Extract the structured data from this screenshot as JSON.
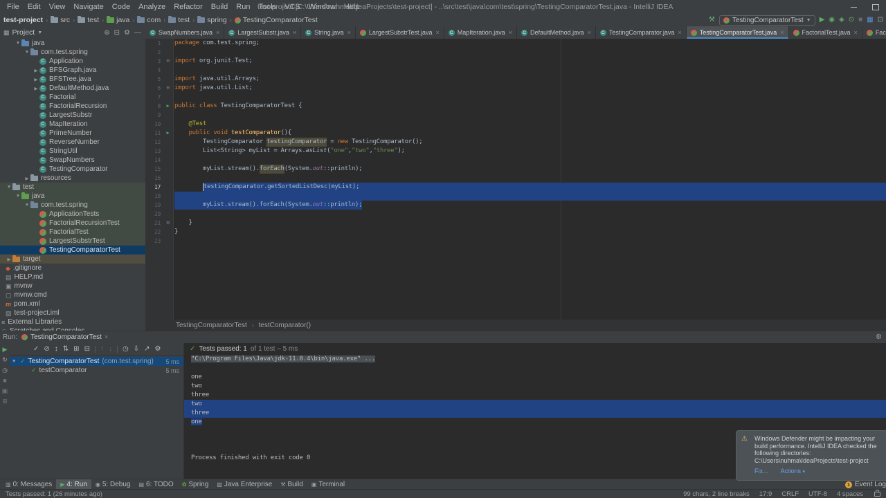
{
  "colors": {
    "accent": "#4A88C7",
    "selection": "#214283",
    "pass_green": "#5fad65",
    "badge_orange": "#e0a23a"
  },
  "titlebar": {
    "menus": [
      "File",
      "Edit",
      "View",
      "Navigate",
      "Code",
      "Analyze",
      "Refactor",
      "Build",
      "Run",
      "Tools",
      "VCS",
      "Window",
      "Help"
    ],
    "title": "test-project [C:\\Users\\nuhma\\IdeaProjects\\test-project] - ..\\src\\test\\java\\com\\test\\spring\\TestingComparatorTest.java - IntelliJ IDEA"
  },
  "navbar": {
    "breadcrumbs": [
      {
        "label": "test-project",
        "icon": null
      },
      {
        "label": "src",
        "icon": "folder"
      },
      {
        "label": "test",
        "icon": "folder"
      },
      {
        "label": "java",
        "icon": "folder-green"
      },
      {
        "label": "com",
        "icon": "pkg"
      },
      {
        "label": "test",
        "icon": "pkg"
      },
      {
        "label": "spring",
        "icon": "pkg"
      },
      {
        "label": "TestingComparatorTest",
        "icon": "testclass"
      }
    ],
    "run_config": "TestingComparatorTest",
    "actions": [
      {
        "t": "icon",
        "g": "⚒",
        "c": "#6aab73",
        "n": "build-hammer-icon"
      },
      {
        "t": "combo"
      },
      {
        "t": "icon",
        "g": "▶",
        "c": "#5fad65",
        "n": "run-button"
      },
      {
        "t": "icon",
        "g": "◉",
        "c": "#5fad65",
        "n": "debug-button"
      },
      {
        "t": "icon",
        "g": "◈",
        "c": "#6aab73",
        "n": "coverage-button"
      },
      {
        "t": "icon",
        "g": "⊙",
        "c": "#6aab73",
        "n": "profiler-button"
      },
      {
        "t": "icon",
        "g": "■",
        "c": "#666b6e",
        "n": "stop-button"
      },
      {
        "t": "icon",
        "g": "▦",
        "c": "#5a8fd6",
        "n": "project-structure-button"
      },
      {
        "t": "icon",
        "g": "⊡",
        "c": "#9fa3a6",
        "n": "preview-button"
      }
    ]
  },
  "project": {
    "header": "Project",
    "header_icons": [
      {
        "g": "⊕",
        "n": "locate-icon"
      },
      {
        "g": "⊟",
        "n": "collapse-all-icon"
      },
      {
        "g": "⚙",
        "n": "settings-icon"
      },
      {
        "g": "―",
        "n": "hide-panel-icon"
      }
    ],
    "items": [
      {
        "l": "java",
        "d": 2,
        "ch": "open",
        "ic": "folder-src",
        "tint": ""
      },
      {
        "l": "com.test.spring",
        "d": 3,
        "ch": "open",
        "ic": "pkg",
        "tint": ""
      },
      {
        "l": "Application",
        "d": 4,
        "ch": "blank",
        "ic": "class",
        "tint": ""
      },
      {
        "l": "BFSGraph.java",
        "d": 4,
        "ch": "closed",
        "ic": "class",
        "tint": ""
      },
      {
        "l": "BFSTree.java",
        "d": 4,
        "ch": "closed",
        "ic": "class",
        "tint": ""
      },
      {
        "l": "DefaultMethod.java",
        "d": 4,
        "ch": "closed",
        "ic": "class",
        "tint": ""
      },
      {
        "l": "Factorial",
        "d": 4,
        "ch": "blank",
        "ic": "class",
        "tint": ""
      },
      {
        "l": "FactorialRecursion",
        "d": 4,
        "ch": "blank",
        "ic": "class",
        "tint": ""
      },
      {
        "l": "LargestSubstr",
        "d": 4,
        "ch": "blank",
        "ic": "class",
        "tint": ""
      },
      {
        "l": "MapIteration",
        "d": 4,
        "ch": "blank",
        "ic": "class",
        "tint": ""
      },
      {
        "l": "PrimeNumber",
        "d": 4,
        "ch": "blank",
        "ic": "class",
        "tint": ""
      },
      {
        "l": "ReverseNumber",
        "d": 4,
        "ch": "blank",
        "ic": "class",
        "tint": ""
      },
      {
        "l": "StringUtil",
        "d": 4,
        "ch": "blank",
        "ic": "class",
        "tint": ""
      },
      {
        "l": "SwapNumbers",
        "d": 4,
        "ch": "blank",
        "ic": "class",
        "tint": ""
      },
      {
        "l": "TestingComparator",
        "d": 4,
        "ch": "blank",
        "ic": "class",
        "tint": ""
      },
      {
        "l": "resources",
        "d": 3,
        "ch": "closed",
        "ic": "folder",
        "tint": ""
      },
      {
        "l": "test",
        "d": 1,
        "ch": "open",
        "ic": "folder",
        "tint": "green"
      },
      {
        "l": "java",
        "d": 2,
        "ch": "open",
        "ic": "folder-green",
        "tint": "green"
      },
      {
        "l": "com.test.spring",
        "d": 3,
        "ch": "open",
        "ic": "pkg",
        "tint": "green"
      },
      {
        "l": "ApplicationTests",
        "d": 4,
        "ch": "blank",
        "ic": "testclass",
        "tint": "green"
      },
      {
        "l": "FactorialRecursionTest",
        "d": 4,
        "ch": "blank",
        "ic": "testclass",
        "tint": "green"
      },
      {
        "l": "FactorialTest",
        "d": 4,
        "ch": "blank",
        "ic": "testclass",
        "tint": "green"
      },
      {
        "l": "LargestSubstrTest",
        "d": 4,
        "ch": "blank",
        "ic": "testclass",
        "tint": "green"
      },
      {
        "l": "TestingComparatorTest",
        "d": 4,
        "ch": "blank",
        "ic": "testclass",
        "tint": "green",
        "sel": true
      },
      {
        "l": "target",
        "d": 1,
        "ch": "closed",
        "ic": "folder-orange",
        "tint": "olive"
      },
      {
        "l": ".gitignore",
        "d": 1,
        "ch": "skip",
        "ic": "git",
        "tint": ""
      },
      {
        "l": "HELP.md",
        "d": 1,
        "ch": "skip",
        "ic": "md",
        "tint": ""
      },
      {
        "l": "mvnw",
        "d": 1,
        "ch": "skip",
        "ic": "sh",
        "tint": ""
      },
      {
        "l": "mvnw.cmd",
        "d": 1,
        "ch": "skip",
        "ic": "cmd",
        "tint": ""
      },
      {
        "l": "pom.xml",
        "d": 1,
        "ch": "skip",
        "ic": "mvn",
        "tint": ""
      },
      {
        "l": "test-project.iml",
        "d": 1,
        "ch": "skip",
        "ic": "iml",
        "tint": ""
      },
      {
        "l": "External Libraries",
        "d": 0,
        "ch": "skip",
        "ic": "lib",
        "tint": ""
      },
      {
        "l": "Scratches and Consoles",
        "d": 0,
        "ch": "skip",
        "ic": "scratch",
        "tint": ""
      }
    ]
  },
  "tabs": [
    {
      "label": "SwapNumbers.java",
      "icon": "class"
    },
    {
      "label": "LargestSubstr.java",
      "icon": "class"
    },
    {
      "label": "String.java",
      "icon": "class"
    },
    {
      "label": "LargestSubstrTest.java",
      "icon": "testclass"
    },
    {
      "label": "MapIteration.java",
      "icon": "class"
    },
    {
      "label": "DefaultMethod.java",
      "icon": "class"
    },
    {
      "label": "TestingComparator.java",
      "icon": "class"
    },
    {
      "label": "TestingComparatorTest.java",
      "icon": "testclass",
      "active": true
    },
    {
      "label": "FactorialTest.java",
      "icon": "testclass"
    },
    {
      "label": "FactorialRecursionTest.java",
      "icon": "testclass"
    }
  ],
  "editor": {
    "breadcrumb": [
      "TestingComparatorTest",
      "testComparator()"
    ],
    "lines": [
      {
        "n": 1,
        "t": [
          [
            "k",
            "package "
          ],
          [
            "p",
            "com.test.spring;"
          ]
        ]
      },
      {
        "n": 2,
        "t": []
      },
      {
        "n": 3,
        "g": "fold",
        "t": [
          [
            "k",
            "import "
          ],
          [
            "p",
            "org.junit.Test;"
          ]
        ]
      },
      {
        "n": 4,
        "t": []
      },
      {
        "n": 5,
        "t": [
          [
            "k",
            "import "
          ],
          [
            "p",
            "java.util.Arrays;"
          ]
        ]
      },
      {
        "n": 6,
        "g": "fold",
        "t": [
          [
            "k",
            "import "
          ],
          [
            "p",
            "java.util.List;"
          ]
        ]
      },
      {
        "n": 7,
        "t": []
      },
      {
        "n": 8,
        "g": "run",
        "t": [
          [
            "k",
            "public class "
          ],
          [
            "p",
            "TestingComparatorTest {"
          ]
        ]
      },
      {
        "n": 9,
        "t": []
      },
      {
        "n": 10,
        "t": [
          [
            "p",
            "    "
          ],
          [
            "a",
            "@Test"
          ]
        ]
      },
      {
        "n": 11,
        "g": "run",
        "t": [
          [
            "p",
            "    "
          ],
          [
            "k",
            "public void "
          ],
          [
            "m",
            "testComparator"
          ],
          [
            "p",
            "(){"
          ]
        ]
      },
      {
        "n": 12,
        "t": [
          [
            "p",
            "        TestingComparator "
          ],
          [
            "o",
            "testingComparator"
          ],
          [
            "p",
            " = "
          ],
          [
            "k",
            "new "
          ],
          [
            "p",
            "TestingComparator();"
          ]
        ]
      },
      {
        "n": 13,
        "t": [
          [
            "p",
            "        List<String> myList = Arrays."
          ],
          [
            "i",
            "asList"
          ],
          [
            "p",
            "("
          ],
          [
            "s",
            "\"one\""
          ],
          [
            "p",
            ","
          ],
          [
            "s",
            "\"two\""
          ],
          [
            "p",
            ","
          ],
          [
            "s",
            "\"three\""
          ],
          [
            "p",
            ");"
          ]
        ]
      },
      {
        "n": 14,
        "t": []
      },
      {
        "n": 15,
        "t": [
          [
            "p",
            "        myList.stream()."
          ],
          [
            "o",
            "forEach"
          ],
          [
            "p",
            "(System."
          ],
          [
            "f",
            "out"
          ],
          [
            "p",
            "::println);"
          ]
        ]
      },
      {
        "n": 16,
        "t": []
      },
      {
        "n": 17,
        "bright": true,
        "sel": "text",
        "fill": true,
        "caret": true,
        "t": [
          [
            "p",
            "        ",
            1
          ],
          [
            "p",
            "testingComparator.getSortedListDesc(myList);"
          ]
        ]
      },
      {
        "n": 18,
        "sel": "line",
        "fill": true,
        "t": []
      },
      {
        "n": 19,
        "sel": "line",
        "fill": false,
        "t": [
          [
            "p",
            "        myList.stream().forEach(System."
          ],
          [
            "f",
            "out"
          ],
          [
            "p",
            "::println);"
          ]
        ]
      },
      {
        "n": 20,
        "t": []
      },
      {
        "n": 21,
        "g": "fold",
        "t": [
          [
            "p",
            "    }"
          ]
        ]
      },
      {
        "n": 22,
        "t": [
          [
            "p",
            "}"
          ]
        ]
      },
      {
        "n": 23,
        "t": []
      }
    ]
  },
  "run_panel": {
    "label": "Run:",
    "tab": "TestingComparatorTest",
    "vtoolbar": [
      {
        "g": "▶",
        "c": "#5fad65",
        "n": "rerun-button"
      },
      {
        "g": "↻",
        "c": "#9fa3a6",
        "n": "rerun-failed-tests-button"
      },
      {
        "g": "◷",
        "c": "#9fa3a6",
        "n": "toggle-auto-test-button"
      },
      {
        "g": "■",
        "c": "#6e7275",
        "n": "stop-process-button"
      },
      {
        "g": "▣",
        "c": "#6e7275",
        "n": "dump-threads-button"
      },
      {
        "g": "⊞",
        "c": "#6e7275",
        "n": "pin-tab-button"
      }
    ],
    "toolbar": [
      {
        "g": "✓",
        "n": "show-passed-button"
      },
      {
        "g": "⊘",
        "n": "show-ignored-button"
      },
      {
        "g": "↕",
        "n": "sort-alphabetically-button"
      },
      {
        "g": "⇅",
        "n": "sort-by-duration-button"
      },
      {
        "g": "⊞",
        "n": "expand-all-button"
      },
      {
        "g": "⊟",
        "n": "collapse-all-button"
      },
      {
        "sep": true
      },
      {
        "g": "↑",
        "dis": true,
        "n": "previous-failed-test-button"
      },
      {
        "g": "↓",
        "dis": true,
        "n": "next-failed-test-button"
      },
      {
        "sep": true
      },
      {
        "g": "◷",
        "n": "test-history-button"
      },
      {
        "g": "⇩",
        "n": "import-test-results-button"
      },
      {
        "g": "↗",
        "n": "export-test-results-button"
      },
      {
        "g": "⚙",
        "n": "test-settings-button"
      }
    ],
    "status": {
      "strong": "Tests passed: 1",
      "dim": " of 1 test – 5 ms"
    },
    "tree": [
      {
        "chev": "▼",
        "label": "TestingComparatorTest",
        "suffix": " (com.test.spring)",
        "time": "5 ms",
        "sel": true,
        "indent": 0
      },
      {
        "chev": "",
        "label": "testComparator",
        "suffix": "",
        "time": "5 ms",
        "sel": false,
        "indent": 1
      }
    ],
    "console": [
      {
        "style": "cmd",
        "text": "\"C:\\Program Files\\Java\\jdk-11.0.4\\bin\\java.exe\" ..."
      },
      {
        "style": "blank",
        "text": ""
      },
      {
        "style": "plain",
        "text": "one"
      },
      {
        "style": "plain",
        "text": "two"
      },
      {
        "style": "plain",
        "text": "three"
      },
      {
        "style": "selfull",
        "text": "two"
      },
      {
        "style": "selfull",
        "text": "three"
      },
      {
        "style": "selword",
        "text": "one"
      },
      {
        "style": "blank",
        "text": ""
      },
      {
        "style": "blank",
        "text": ""
      },
      {
        "style": "blank",
        "text": ""
      },
      {
        "style": "plain",
        "text": "Process finished with exit code 0"
      }
    ]
  },
  "notification": {
    "text": "Windows Defender might be impacting your build performance. IntelliJ IDEA checked the following directories:",
    "path": "C:\\Users\\nuhma\\IdeaProjects\\test-project",
    "fix_label": "Fix...",
    "actions_label": "Actions"
  },
  "toolwindow_bar": {
    "items": [
      {
        "num": "0:",
        "label": "Messages",
        "g": "▥",
        "gc": "#9fa3a6"
      },
      {
        "num": "4:",
        "label": "Run",
        "g": "▶",
        "gc": "#5fad65",
        "active": true
      },
      {
        "num": "5:",
        "label": "Debug",
        "g": "◉",
        "gc": "#9fa3a6"
      },
      {
        "num": "6:",
        "label": "TODO",
        "g": "▤",
        "gc": "#9fa3a6"
      },
      {
        "num": "",
        "label": "Spring",
        "g": "✿",
        "gc": "#6db33f"
      },
      {
        "num": "",
        "label": "Java Enterprise",
        "g": "▧",
        "gc": "#9fa3a6"
      },
      {
        "num": "",
        "label": "Build",
        "g": "⚒",
        "gc": "#9fa3a6"
      },
      {
        "num": "",
        "label": "Terminal",
        "g": "▣",
        "gc": "#9fa3a6"
      }
    ],
    "event_log": {
      "badge": "1",
      "label": "Event Log"
    }
  },
  "statusbar": {
    "left": "Tests passed: 1 (26 minutes ago)",
    "right": [
      "99 chars, 2 line breaks",
      "17:9",
      "CRLF",
      "UTF-8",
      "4 spaces"
    ]
  }
}
